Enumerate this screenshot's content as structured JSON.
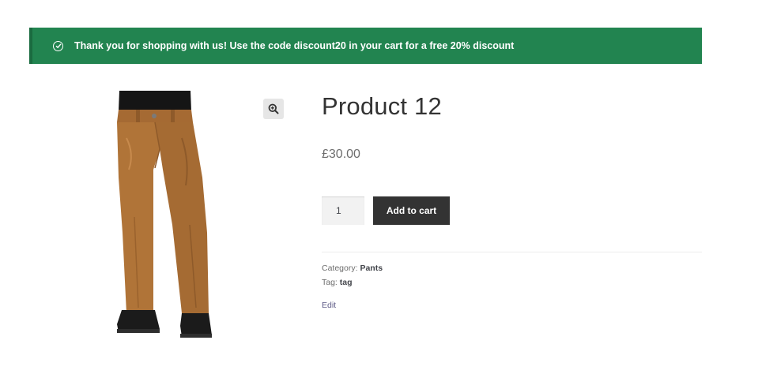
{
  "notice": {
    "icon": "check-circle-icon",
    "text": "Thank you for shopping with us! Use the code discount20 in your cart for a free 20% discount",
    "color": "#228450"
  },
  "gallery": {
    "image": "product-image-brown-pants",
    "zoom_icon": "zoom-in-icon"
  },
  "product": {
    "title": "Product 12",
    "price": "£30.00",
    "quantity": "1",
    "add_to_cart_label": "Add to cart",
    "category_label": "Category:",
    "category": "Pants",
    "tag_label": "Tag:",
    "tag": "tag",
    "edit_label": "Edit"
  }
}
